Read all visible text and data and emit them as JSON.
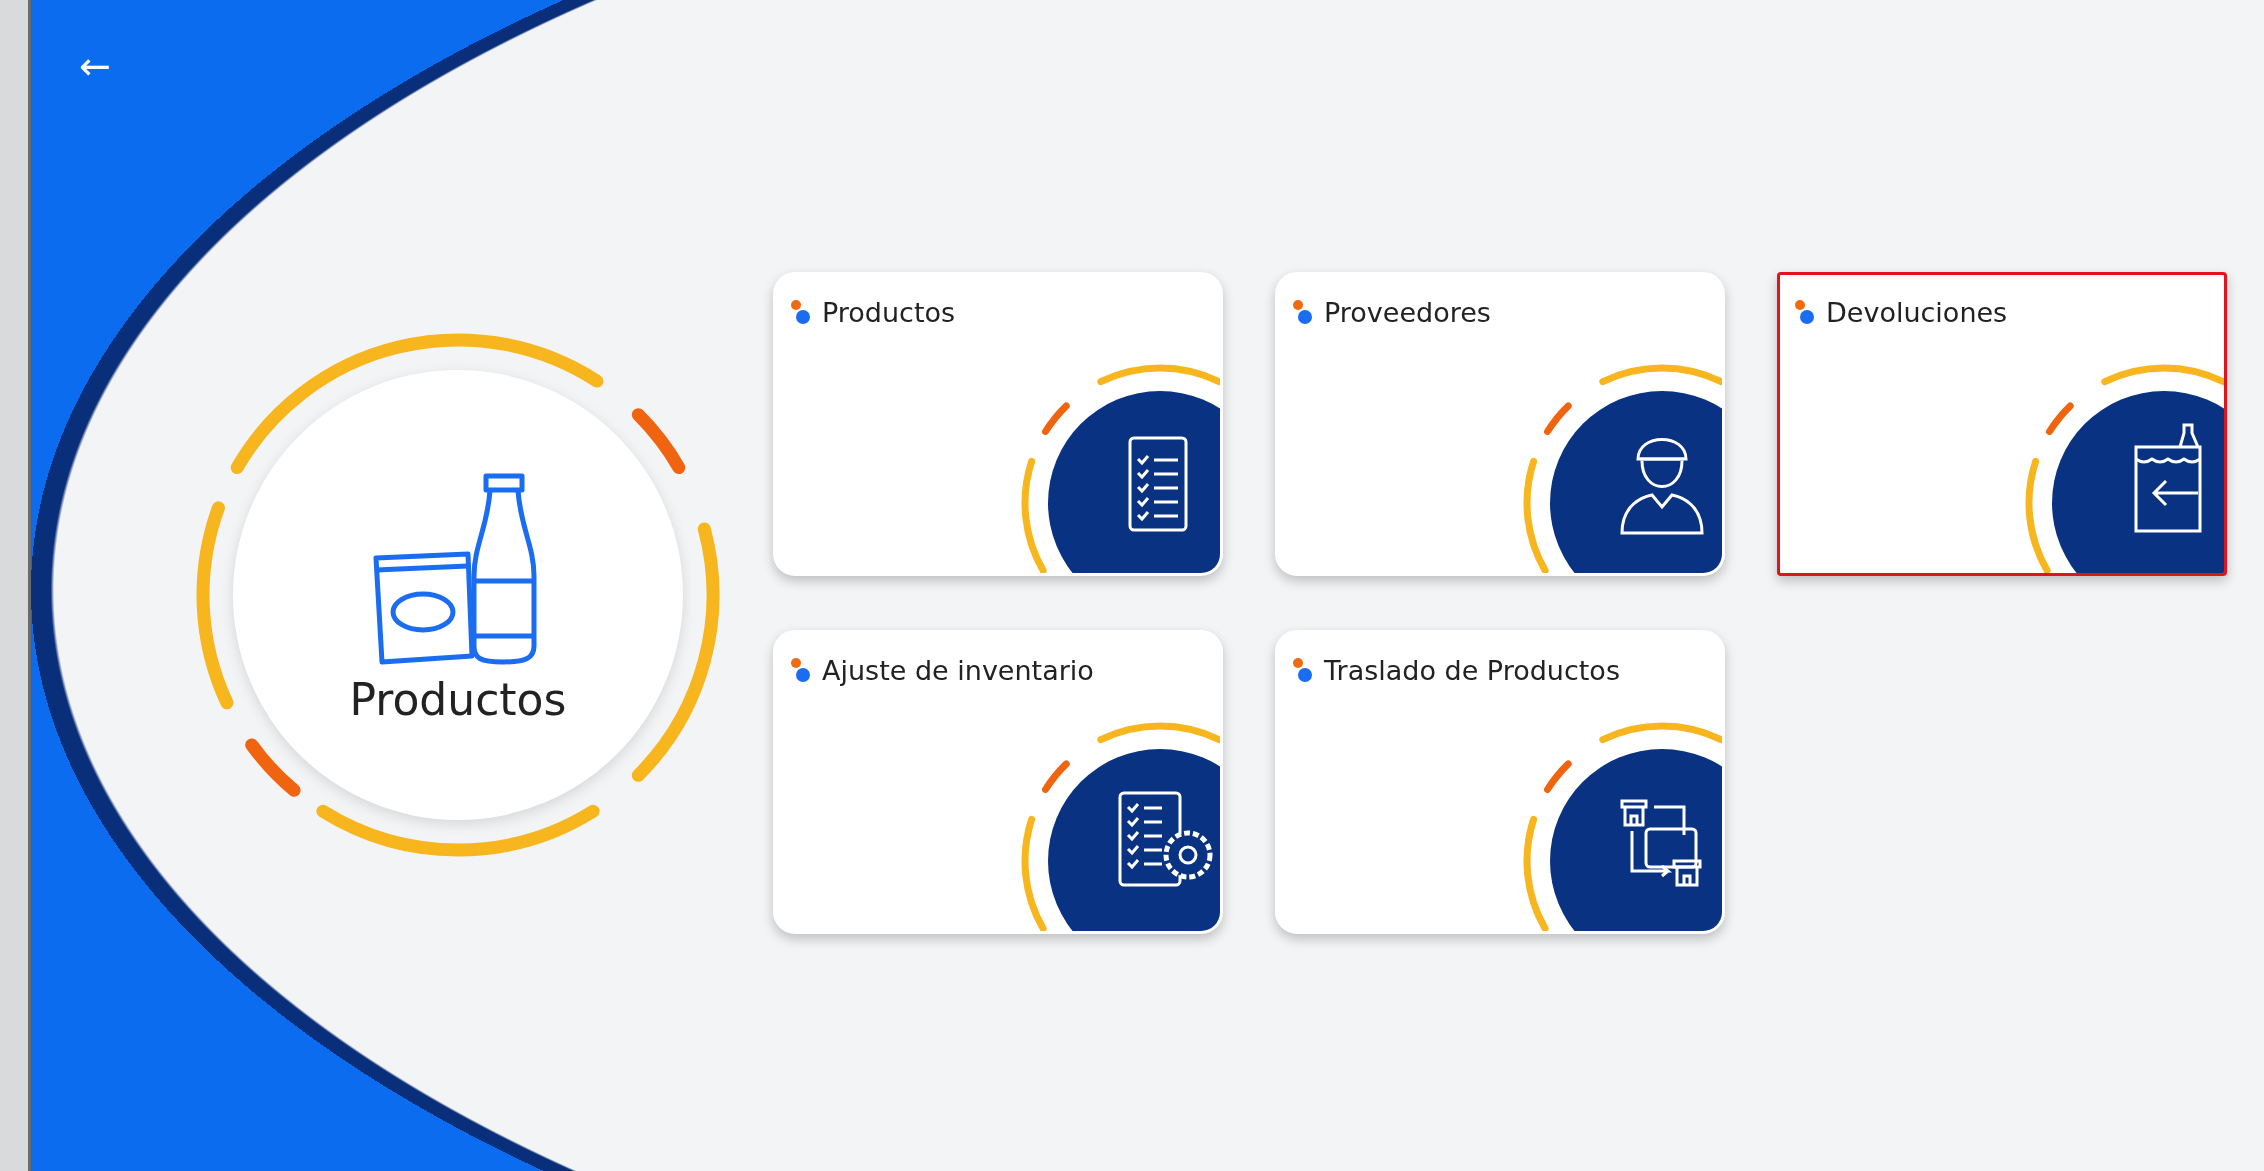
{
  "back_button": {
    "label": "←"
  },
  "hero": {
    "title": "Productos"
  },
  "cards": [
    {
      "title": "Productos",
      "kind": "list",
      "selected": false
    },
    {
      "title": "Proveedores",
      "kind": "supplier",
      "selected": false
    },
    {
      "title": "Devoluciones",
      "kind": "returns",
      "selected": true
    },
    {
      "title": "Ajuste de inventario",
      "kind": "adjust",
      "selected": false
    },
    {
      "title": "Traslado de Productos",
      "kind": "transfer",
      "selected": false
    }
  ]
}
